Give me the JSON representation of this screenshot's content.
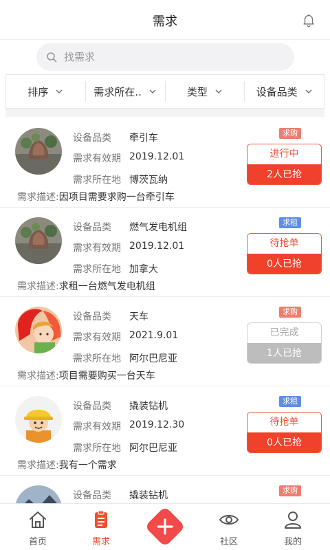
{
  "header": {
    "title": "需求"
  },
  "search": {
    "placeholder": "找需求"
  },
  "filters": [
    {
      "label": "排序"
    },
    {
      "label": "需求所在.."
    },
    {
      "label": "类型"
    },
    {
      "label": "设备品类"
    }
  ],
  "labels": {
    "category": "设备品类",
    "validity": "需求有效期",
    "location": "需求所在地",
    "description": "需求描述:"
  },
  "items": [
    {
      "category": "牵引车",
      "validity": "2019.12.01",
      "location": "博茨瓦纳",
      "description": "因项目需要求购一台牵引车",
      "tag": "求购",
      "tag_color": "#ee7d6d",
      "status": "进行中",
      "grabbed": "2人已抢",
      "avatar": "plant-photo"
    },
    {
      "category": "燃气发电机组",
      "validity": "2019.12.01",
      "location": "加拿大",
      "description": "求租一台燃气发电机组",
      "tag": "求租",
      "tag_color": "#5f8ee8",
      "status": "待抢单",
      "grabbed": "0人已抢",
      "avatar": "plant-photo"
    },
    {
      "category": "天车",
      "validity": "2021.9.01",
      "location": "阿尔巴尼亚",
      "description": "项目需要购买一台天车",
      "tag": "求购",
      "tag_color": "#ee7d6d",
      "status": "已完成",
      "grabbed": "1人已抢",
      "avatar": "cartoon-girl"
    },
    {
      "category": "撬装钻机",
      "validity": "2019.12.30",
      "location": "阿尔巴尼亚",
      "description": "我有一个需求",
      "tag": "求租",
      "tag_color": "#5f8ee8",
      "status": "待抢单",
      "grabbed": "0人已抢",
      "avatar": "worker-helmet"
    },
    {
      "category": "撬装钻机",
      "tag": "求购",
      "tag_color": "#ee7d6d",
      "avatar": "landscape-photo"
    }
  ],
  "tabbar": [
    {
      "label": "首页",
      "icon": "home-icon"
    },
    {
      "label": "需求",
      "icon": "document-icon",
      "active": true
    },
    {
      "label": "",
      "icon": "plus-icon"
    },
    {
      "label": "社区",
      "icon": "eye-icon"
    },
    {
      "label": "我的",
      "icon": "user-icon"
    }
  ],
  "colors": {
    "accent": "#f0412a",
    "done": "#bdbdbd",
    "buy_tag": "#ee7d6d",
    "rent_tag": "#5f8ee8"
  }
}
